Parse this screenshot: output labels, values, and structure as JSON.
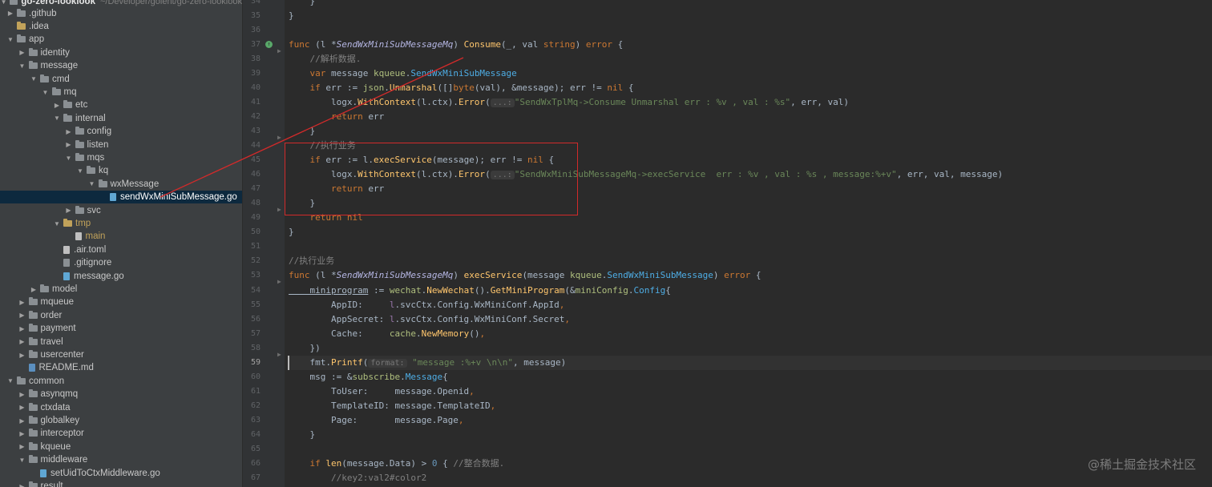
{
  "project": {
    "root_name": "go-zero-looklook",
    "root_path": "~/Developer/golent/go-zero-looklook"
  },
  "tree": [
    {
      "label": ".github",
      "depth": 0,
      "type": "folder",
      "chevron": "right"
    },
    {
      "label": ".idea",
      "depth": 0,
      "type": "folder-orange",
      "chevron": "none"
    },
    {
      "label": "app",
      "depth": 0,
      "type": "folder",
      "chevron": "down"
    },
    {
      "label": "identity",
      "depth": 1,
      "type": "folder",
      "chevron": "right"
    },
    {
      "label": "message",
      "depth": 1,
      "type": "folder",
      "chevron": "down"
    },
    {
      "label": "cmd",
      "depth": 2,
      "type": "folder",
      "chevron": "down"
    },
    {
      "label": "mq",
      "depth": 3,
      "type": "folder",
      "chevron": "down"
    },
    {
      "label": "etc",
      "depth": 4,
      "type": "folder",
      "chevron": "right"
    },
    {
      "label": "internal",
      "depth": 4,
      "type": "folder",
      "chevron": "down"
    },
    {
      "label": "config",
      "depth": 5,
      "type": "folder",
      "chevron": "right"
    },
    {
      "label": "listen",
      "depth": 5,
      "type": "folder",
      "chevron": "right"
    },
    {
      "label": "mqs",
      "depth": 5,
      "type": "folder",
      "chevron": "down"
    },
    {
      "label": "kq",
      "depth": 6,
      "type": "folder",
      "chevron": "down"
    },
    {
      "label": "wxMessage",
      "depth": 7,
      "type": "folder",
      "chevron": "down"
    },
    {
      "label": "sendWxMiniSubMessage.go",
      "depth": 8,
      "type": "file-go",
      "chevron": "none",
      "selected": true
    },
    {
      "label": "svc",
      "depth": 5,
      "type": "folder",
      "chevron": "right"
    },
    {
      "label": "tmp",
      "depth": 4,
      "type": "folder-orange",
      "chevron": "down",
      "orange": true
    },
    {
      "label": "main",
      "depth": 5,
      "type": "file",
      "chevron": "none",
      "orange": true
    },
    {
      "label": ".air.toml",
      "depth": 4,
      "type": "file",
      "chevron": "none"
    },
    {
      "label": ".gitignore",
      "depth": 4,
      "type": "file-git",
      "chevron": "none"
    },
    {
      "label": "message.go",
      "depth": 4,
      "type": "file-go",
      "chevron": "none"
    },
    {
      "label": "model",
      "depth": 2,
      "type": "folder",
      "chevron": "right"
    },
    {
      "label": "mqueue",
      "depth": 1,
      "type": "folder",
      "chevron": "right"
    },
    {
      "label": "order",
      "depth": 1,
      "type": "folder",
      "chevron": "right"
    },
    {
      "label": "payment",
      "depth": 1,
      "type": "folder",
      "chevron": "right"
    },
    {
      "label": "travel",
      "depth": 1,
      "type": "folder",
      "chevron": "right"
    },
    {
      "label": "usercenter",
      "depth": 1,
      "type": "folder",
      "chevron": "right"
    },
    {
      "label": "README.md",
      "depth": 1,
      "type": "file-md",
      "chevron": "none"
    },
    {
      "label": "common",
      "depth": 0,
      "type": "folder",
      "chevron": "down"
    },
    {
      "label": "asynqmq",
      "depth": 1,
      "type": "folder",
      "chevron": "right"
    },
    {
      "label": "ctxdata",
      "depth": 1,
      "type": "folder",
      "chevron": "right"
    },
    {
      "label": "globalkey",
      "depth": 1,
      "type": "folder",
      "chevron": "right"
    },
    {
      "label": "interceptor",
      "depth": 1,
      "type": "folder",
      "chevron": "right"
    },
    {
      "label": "kqueue",
      "depth": 1,
      "type": "folder",
      "chevron": "right"
    },
    {
      "label": "middleware",
      "depth": 1,
      "type": "folder",
      "chevron": "down"
    },
    {
      "label": "setUidToCtxMiddleware.go",
      "depth": 2,
      "type": "file-go",
      "chevron": "none"
    },
    {
      "label": "result",
      "depth": 1,
      "type": "folder",
      "chevron": "right"
    }
  ],
  "editor": {
    "current_line": 59,
    "lines": [
      {
        "no": 34,
        "tokens": [
          [
            "",
            "    }"
          ]
        ]
      },
      {
        "no": 35,
        "tokens": [
          [
            "",
            "}"
          ]
        ]
      },
      {
        "no": 36,
        "tokens": []
      },
      {
        "no": 37,
        "tokens": [
          [
            "kw",
            "func "
          ],
          [
            "",
            "(l *"
          ],
          [
            "typ",
            "SendWxMiniSubMessageMq"
          ],
          [
            "",
            ") "
          ],
          [
            "fn",
            "Consume"
          ],
          [
            "",
            "(_, val "
          ],
          [
            "kw",
            "string"
          ],
          [
            "",
            ") "
          ],
          [
            "kw",
            "error"
          ],
          [
            "",
            " {"
          ]
        ]
      },
      {
        "no": 38,
        "tokens": [
          [
            "cmt",
            "    //解析数据."
          ]
        ]
      },
      {
        "no": 39,
        "tokens": [
          [
            "kw",
            "    var "
          ],
          [
            "",
            "message "
          ],
          [
            "pkg",
            "kqueue"
          ],
          [
            "",
            "."
          ],
          [
            "typ2",
            "SendWxMiniSubMessage"
          ]
        ]
      },
      {
        "no": 40,
        "tokens": [
          [
            "kw",
            "    if "
          ],
          [
            "",
            "err := "
          ],
          [
            "pkg",
            "json"
          ],
          [
            "",
            "."
          ],
          [
            "fn",
            "Unmarshal"
          ],
          [
            "",
            "([]"
          ],
          [
            "kw",
            "byte"
          ],
          [
            "",
            "(val), &message); err != "
          ],
          [
            "kw",
            "nil"
          ],
          [
            "",
            " {"
          ]
        ]
      },
      {
        "no": 41,
        "tokens": [
          [
            "",
            "        logx."
          ],
          [
            "fn",
            "WithContext"
          ],
          [
            "",
            "(l.ctx)."
          ],
          [
            "fn",
            "Error"
          ],
          [
            "",
            "("
          ],
          [
            "hint",
            "...:"
          ],
          [
            "str",
            "\"SendWxTplMq->Consume Unmarshal err : %v , val : %s\""
          ],
          [
            "",
            ", err, val)"
          ]
        ]
      },
      {
        "no": 42,
        "tokens": [
          [
            "kw",
            "        return "
          ],
          [
            "",
            "err"
          ]
        ]
      },
      {
        "no": 43,
        "tokens": [
          [
            "",
            "    }"
          ]
        ]
      },
      {
        "no": 44,
        "tokens": [
          [
            "cmt",
            "    //执行业务"
          ]
        ]
      },
      {
        "no": 45,
        "tokens": [
          [
            "kw",
            "    if "
          ],
          [
            "",
            "err := l."
          ],
          [
            "fn",
            "execService"
          ],
          [
            "",
            "(message); err != "
          ],
          [
            "kw",
            "nil"
          ],
          [
            "",
            " {"
          ]
        ]
      },
      {
        "no": 46,
        "tokens": [
          [
            "",
            "        logx."
          ],
          [
            "fn",
            "WithContext"
          ],
          [
            "",
            "(l.ctx)."
          ],
          [
            "fn",
            "Error"
          ],
          [
            "",
            "("
          ],
          [
            "hint",
            "...:"
          ],
          [
            "str",
            "\"SendWxMiniSubMessageMq->execService  err : %v , val : %s , message:%+v\""
          ],
          [
            "",
            ", err, val, message)"
          ]
        ]
      },
      {
        "no": 47,
        "tokens": [
          [
            "kw",
            "        return "
          ],
          [
            "",
            "err"
          ]
        ]
      },
      {
        "no": 48,
        "tokens": [
          [
            "",
            "    }"
          ]
        ]
      },
      {
        "no": 49,
        "tokens": [
          [
            "kw",
            "    return nil"
          ]
        ]
      },
      {
        "no": 50,
        "tokens": [
          [
            "",
            "}"
          ]
        ]
      },
      {
        "no": 51,
        "tokens": []
      },
      {
        "no": 52,
        "tokens": [
          [
            "cmt",
            "//执行业务"
          ]
        ]
      },
      {
        "no": 53,
        "tokens": [
          [
            "kw",
            "func "
          ],
          [
            "",
            "(l *"
          ],
          [
            "typ",
            "SendWxMiniSubMessageMq"
          ],
          [
            "",
            ") "
          ],
          [
            "fn",
            "execService"
          ],
          [
            "",
            "(message "
          ],
          [
            "pkg",
            "kqueue"
          ],
          [
            "",
            "."
          ],
          [
            "typ2",
            "SendWxMiniSubMessage"
          ],
          [
            "",
            ") "
          ],
          [
            "kw",
            "error"
          ],
          [
            "",
            " {"
          ]
        ]
      },
      {
        "no": 54,
        "tokens": [
          [
            "ul",
            "    miniprogram"
          ],
          [
            "",
            " := "
          ],
          [
            "pkg",
            "wechat"
          ],
          [
            "",
            "."
          ],
          [
            "fn",
            "NewWechat"
          ],
          [
            "",
            "()."
          ],
          [
            "fn",
            "GetMiniProgram"
          ],
          [
            "",
            "(&"
          ],
          [
            "pkg",
            "miniConfig"
          ],
          [
            "",
            "."
          ],
          [
            "typ2",
            "Config"
          ],
          [
            "",
            "{"
          ]
        ]
      },
      {
        "no": 55,
        "tokens": [
          [
            "",
            "        AppID:     "
          ],
          [
            "fld",
            "l"
          ],
          [
            "",
            ".svcCtx.Config.WxMiniConf.AppId"
          ],
          [
            "kw",
            ","
          ]
        ]
      },
      {
        "no": 56,
        "tokens": [
          [
            "",
            "        AppSecret: "
          ],
          [
            "fld",
            "l"
          ],
          [
            "",
            ".svcCtx.Config.WxMiniConf.Secret"
          ],
          [
            "kw",
            ","
          ]
        ]
      },
      {
        "no": 57,
        "tokens": [
          [
            "",
            "        Cache:     "
          ],
          [
            "pkg",
            "cache"
          ],
          [
            "",
            "."
          ],
          [
            "fn",
            "NewMemory"
          ],
          [
            "",
            "()"
          ],
          [
            "kw",
            ","
          ]
        ]
      },
      {
        "no": 58,
        "tokens": [
          [
            "",
            "    })"
          ]
        ]
      },
      {
        "no": 59,
        "tokens": [
          [
            "",
            "    fmt."
          ],
          [
            "fn",
            "Printf"
          ],
          [
            "",
            "("
          ],
          [
            "hint",
            "format:"
          ],
          [
            "str",
            " \"message :%+v \\n\\n\""
          ],
          [
            "",
            ", message)"
          ]
        ]
      },
      {
        "no": 60,
        "tokens": [
          [
            "",
            "    msg := &"
          ],
          [
            "pkg",
            "subscribe"
          ],
          [
            "",
            "."
          ],
          [
            "typ2",
            "Message"
          ],
          [
            "",
            "{"
          ]
        ]
      },
      {
        "no": 61,
        "tokens": [
          [
            "",
            "        ToUser:     message.Openid"
          ],
          [
            "kw",
            ","
          ]
        ]
      },
      {
        "no": 62,
        "tokens": [
          [
            "",
            "        TemplateID: message.TemplateID"
          ],
          [
            "kw",
            ","
          ]
        ]
      },
      {
        "no": 63,
        "tokens": [
          [
            "",
            "        Page:       message.Page"
          ],
          [
            "kw",
            ","
          ]
        ]
      },
      {
        "no": 64,
        "tokens": [
          [
            "",
            "    }"
          ]
        ]
      },
      {
        "no": 65,
        "tokens": []
      },
      {
        "no": 66,
        "tokens": [
          [
            "kw",
            "    if "
          ],
          [
            "fn",
            "len"
          ],
          [
            "",
            "(message.Data) > "
          ],
          [
            "num",
            "0"
          ],
          [
            "",
            " { "
          ],
          [
            "cmt",
            "//整合数据."
          ]
        ]
      },
      {
        "no": 67,
        "tokens": [
          [
            "cmt",
            "        //key2:val2#color2"
          ]
        ]
      }
    ]
  },
  "icons": {
    "run_gutter_icon": "run-gutter-icon",
    "fold_marker": "fold-marker-icon"
  },
  "annotation": {
    "color": "#d22a2a"
  },
  "watermark": "@稀土掘金技术社区"
}
